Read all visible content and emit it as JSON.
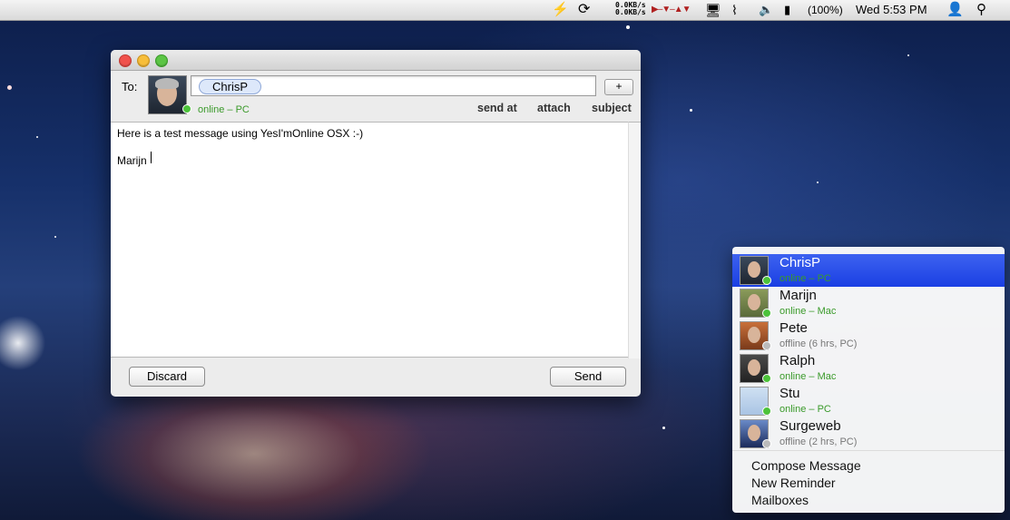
{
  "menubar": {
    "net_up": "0.0KB/s",
    "net_down": "0.0KB/s",
    "battery": "(100%)",
    "clock": "Wed 5:53 PM"
  },
  "compose": {
    "to_label": "To:",
    "recipient": "ChrisP",
    "recipient_status": "online – PC",
    "add_label": "+",
    "links": {
      "send_at": "send at",
      "attach": "attach",
      "subject": "subject"
    },
    "body_line1": "Here is a test message using YesI'mOnline OSX :-)",
    "body_line2": "Marijn",
    "discard": "Discard",
    "send": "Send"
  },
  "contacts": [
    {
      "name": "ChrisP",
      "status": "online – PC",
      "online": true,
      "selected": true
    },
    {
      "name": "Marijn",
      "status": "online – Mac",
      "online": true,
      "selected": false
    },
    {
      "name": "Pete",
      "status": "offline (6 hrs, PC)",
      "online": false,
      "selected": false
    },
    {
      "name": "Ralph",
      "status": "online – Mac",
      "online": true,
      "selected": false
    },
    {
      "name": "Stu",
      "status": "online – PC",
      "online": true,
      "selected": false
    },
    {
      "name": "Surgeweb",
      "status": "offline (2 hrs, PC)",
      "online": false,
      "selected": false
    }
  ],
  "menu_actions": [
    "Compose Message",
    "New Reminder",
    "Mailboxes"
  ],
  "colors": {
    "online": "#3a9a2a",
    "offline": "#777777",
    "selection": "#2447e8"
  }
}
